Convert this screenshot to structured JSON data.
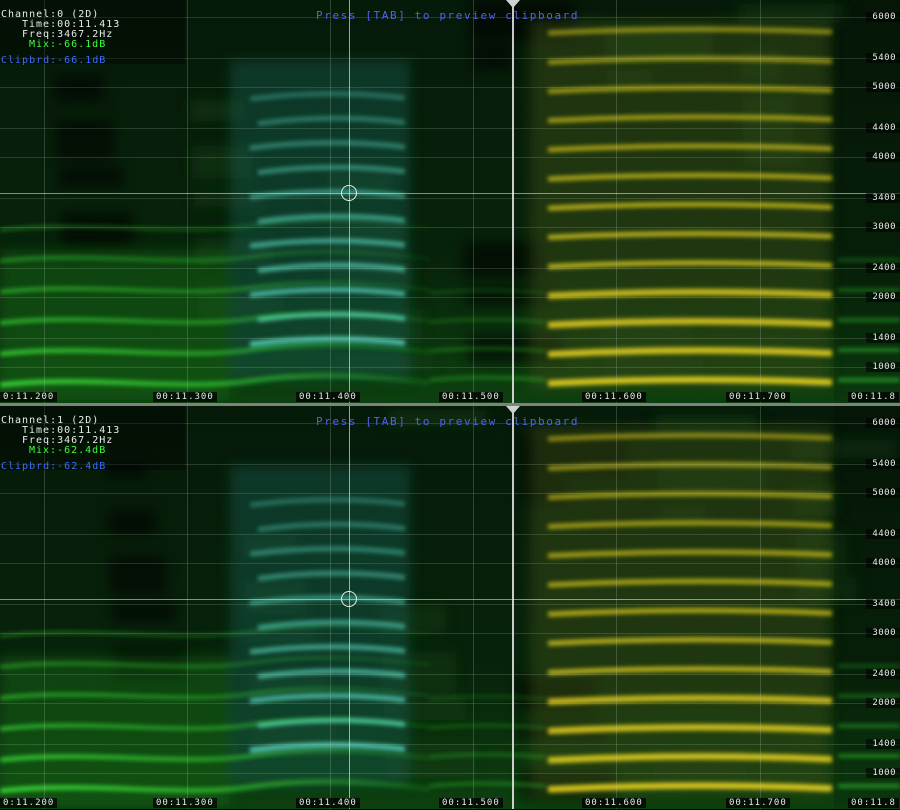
{
  "hint_text": "Press [TAB] to preview clipboard",
  "colors": {
    "green_harmonic": "#3ee83a",
    "cyan_harmonic": "#59d8c2",
    "yellow_harmonic": "#e6d21e",
    "info_white": "#e8ece8",
    "info_green": "#3cff3c",
    "info_blue": "#3b6cff"
  },
  "time_axis": {
    "tick_labels": [
      "0:11.200",
      "00:11.300",
      "00:11.400",
      "00:11.500",
      "00:11.600",
      "00:11.700",
      "00:11.8"
    ],
    "tick_values_s": [
      11.2,
      11.3,
      11.4,
      11.5,
      11.6,
      11.7,
      11.8
    ],
    "cursor_time_s": 11.413,
    "playhead_time_s": 11.528
  },
  "freq_axis": {
    "tick_labels": [
      "6000",
      "5400",
      "5000",
      "4400",
      "4000",
      "3400",
      "3000",
      "2400",
      "2000",
      "1400",
      "1000"
    ],
    "tick_values_hz": [
      6000,
      5400,
      5000,
      4400,
      4000,
      3400,
      3000,
      2400,
      2000,
      1400,
      1000
    ],
    "cursor_freq_hz": 3467.2
  },
  "channels": [
    {
      "channel": "Channel:0 (2D)",
      "time": "Time:00:11.413",
      "freq": "Freq:3467.2Hz",
      "mix": "Mix:-66.1dB",
      "clipbrd": "Clipbrd:-66.1dB"
    },
    {
      "channel": "Channel:1 (2D)",
      "time": "Time:00:11.413",
      "freq": "Freq:3467.2Hz",
      "mix": "Mix:-62.4dB",
      "clipbrd": "Clipbrd:-62.4dB"
    }
  ]
}
